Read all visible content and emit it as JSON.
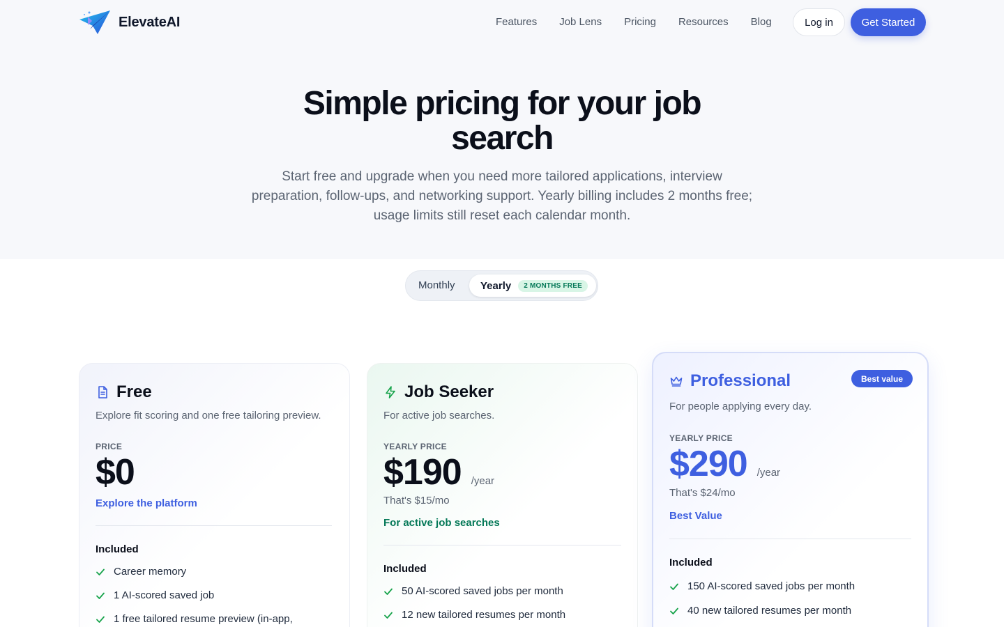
{
  "brand": {
    "name": "ElevateAI"
  },
  "nav": {
    "items": [
      "Features",
      "Job Lens",
      "Pricing",
      "Resources",
      "Blog"
    ]
  },
  "header": {
    "login_label": "Log in",
    "cta_label": "Get Started"
  },
  "hero": {
    "title": "Simple pricing for your job search",
    "subtitle": "Start free and upgrade when you need more tailored applications, interview preparation, follow-ups, and networking support. Yearly billing includes 2 months free; usage limits still reset each calendar month."
  },
  "billing_toggle": {
    "monthly_label": "Monthly",
    "yearly_label": "Yearly",
    "yearly_badge": "2 MONTHS FREE",
    "selected": "Yearly"
  },
  "plans": [
    {
      "name": "Free",
      "icon": "document-icon",
      "description": "Explore fit scoring and one free tailoring preview.",
      "price_label": "PRICE",
      "price": "$0",
      "tagline": "Explore the platform",
      "included_label": "Included",
      "features": [
        "Career memory",
        "1 AI-scored saved job",
        "1 free tailored resume preview (in-app,"
      ]
    },
    {
      "name": "Job Seeker",
      "icon": "lightning-icon",
      "description": "For active job searches.",
      "price_label": "YEARLY PRICE",
      "price": "$190",
      "price_unit": "/year",
      "price_note": "That's $15/mo",
      "tagline": "For active job searches",
      "included_label": "Included",
      "features": [
        "50 AI-scored saved jobs per month",
        "12 new tailored resumes per month"
      ]
    },
    {
      "name": "Professional",
      "icon": "crown-icon",
      "badge": "Best value",
      "description": "For people applying every day.",
      "price_label": "YEARLY PRICE",
      "price": "$290",
      "price_unit": "/year",
      "price_note": "That's $24/mo",
      "tagline": "Best Value",
      "included_label": "Included",
      "features": [
        "150 AI-scored saved jobs per month",
        "40 new tailored resumes per month"
      ]
    }
  ],
  "colors": {
    "accent": "#3e5fe0",
    "success": "#047857",
    "check": "#16a34a",
    "text": "#0b0f1a",
    "muted": "#5b6472"
  }
}
